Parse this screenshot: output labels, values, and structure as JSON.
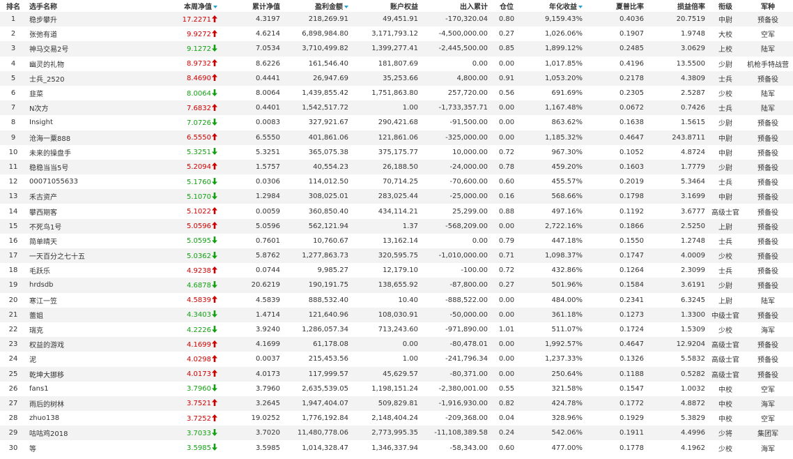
{
  "colors": {
    "up": "#cc0000",
    "down": "#12a012",
    "sort": "#2aa0c8",
    "stripe": "#f3f3f3"
  },
  "icons": {
    "rise": "up-arrow-icon",
    "fall": "down-arrow-icon",
    "sort": "sort-desc-icon"
  },
  "headers": {
    "rank": "排名",
    "name": "选手名称",
    "week_nav": "本周净值",
    "total_nav": "累计净值",
    "profit": "盈利金额",
    "equity": "账户权益",
    "inout": "出入累计",
    "position": "仓位",
    "annual": "年化收益",
    "sharpe": "夏普比率",
    "pl_ratio": "损益倍率",
    "rank_title": "衔级",
    "branch": "军种"
  },
  "sorted_columns": [
    "week_nav",
    "profit",
    "annual"
  ],
  "rows": [
    {
      "rank": "1",
      "name": "稳步攀升",
      "week_nav": "17.2271",
      "dir": "up",
      "total_nav": "4.3197",
      "profit": "218,269.91",
      "equity": "49,451.91",
      "inout": "-170,320.04",
      "position": "0.80",
      "annual": "9,159.43%",
      "sharpe": "0.4036",
      "pl_ratio": "20.7519",
      "rank_title": "中尉",
      "branch": "预备役"
    },
    {
      "rank": "2",
      "name": "张弛有道",
      "week_nav": "9.9272",
      "dir": "up",
      "total_nav": "4.6214",
      "profit": "6,898,984.80",
      "equity": "3,171,793.12",
      "inout": "-4,500,000.00",
      "position": "0.27",
      "annual": "1,026.06%",
      "sharpe": "0.1907",
      "pl_ratio": "1.9748",
      "rank_title": "大校",
      "branch": "空军"
    },
    {
      "rank": "3",
      "name": "神马交易2号",
      "week_nav": "9.1272",
      "dir": "down",
      "total_nav": "7.0534",
      "profit": "3,710,499.82",
      "equity": "1,399,277.41",
      "inout": "-2,445,500.00",
      "position": "0.85",
      "annual": "1,899.12%",
      "sharpe": "0.2485",
      "pl_ratio": "3.0629",
      "rank_title": "上校",
      "branch": "陆军"
    },
    {
      "rank": "4",
      "name": "幽灵的礼物",
      "week_nav": "8.9732",
      "dir": "up",
      "total_nav": "8.6226",
      "profit": "161,546.40",
      "equity": "181,807.69",
      "inout": "0.00",
      "position": "0.00",
      "annual": "1,017.85%",
      "sharpe": "0.4196",
      "pl_ratio": "13.5500",
      "rank_title": "少尉",
      "branch": "机枪手特战营"
    },
    {
      "rank": "5",
      "name": "士兵_2520",
      "week_nav": "8.4690",
      "dir": "up",
      "total_nav": "0.4441",
      "profit": "26,947.69",
      "equity": "35,253.66",
      "inout": "4,800.00",
      "position": "0.91",
      "annual": "1,053.20%",
      "sharpe": "0.2178",
      "pl_ratio": "4.3809",
      "rank_title": "士兵",
      "branch": "预备役"
    },
    {
      "rank": "6",
      "name": "韭菜",
      "week_nav": "8.0064",
      "dir": "down",
      "total_nav": "8.0064",
      "profit": "1,439,855.42",
      "equity": "1,751,863.80",
      "inout": "257,720.00",
      "position": "0.56",
      "annual": "691.69%",
      "sharpe": "0.2305",
      "pl_ratio": "2.5287",
      "rank_title": "少校",
      "branch": "陆军"
    },
    {
      "rank": "7",
      "name": "N次方",
      "week_nav": "7.6832",
      "dir": "up",
      "total_nav": "0.4401",
      "profit": "1,542,517.72",
      "equity": "1.00",
      "inout": "-1,733,357.71",
      "position": "0.00",
      "annual": "1,167.48%",
      "sharpe": "0.0672",
      "pl_ratio": "0.7426",
      "rank_title": "士兵",
      "branch": "陆军"
    },
    {
      "rank": "8",
      "name": "Insight",
      "week_nav": "7.0726",
      "dir": "down",
      "total_nav": "0.0083",
      "profit": "327,921.67",
      "equity": "290,421.68",
      "inout": "-91,500.00",
      "position": "0.00",
      "annual": "863.62%",
      "sharpe": "0.1638",
      "pl_ratio": "1.5615",
      "rank_title": "少尉",
      "branch": "预备役"
    },
    {
      "rank": "9",
      "name": "沧海一粟888",
      "week_nav": "6.5550",
      "dir": "up",
      "total_nav": "6.5550",
      "profit": "401,861.06",
      "equity": "121,861.06",
      "inout": "-325,000.00",
      "position": "0.00",
      "annual": "1,185.32%",
      "sharpe": "0.4647",
      "pl_ratio": "243.8711",
      "rank_title": "中尉",
      "branch": "预备役"
    },
    {
      "rank": "10",
      "name": "未来的操盘手",
      "week_nav": "5.3251",
      "dir": "down",
      "total_nav": "5.3251",
      "profit": "365,075.38",
      "equity": "375,175.77",
      "inout": "10,000.00",
      "position": "0.72",
      "annual": "967.30%",
      "sharpe": "0.1052",
      "pl_ratio": "4.8724",
      "rank_title": "中尉",
      "branch": "预备役"
    },
    {
      "rank": "11",
      "name": "稳稳当当5号",
      "week_nav": "5.2094",
      "dir": "up",
      "total_nav": "1.5757",
      "profit": "40,554.23",
      "equity": "26,188.50",
      "inout": "-24,000.00",
      "position": "0.78",
      "annual": "459.20%",
      "sharpe": "0.1603",
      "pl_ratio": "1.7779",
      "rank_title": "少尉",
      "branch": "预备役"
    },
    {
      "rank": "12",
      "name": "00071055633",
      "week_nav": "5.1760",
      "dir": "down",
      "total_nav": "0.0306",
      "profit": "114,012.50",
      "equity": "70,714.25",
      "inout": "-70,600.00",
      "position": "0.60",
      "annual": "455.57%",
      "sharpe": "0.2019",
      "pl_ratio": "5.3464",
      "rank_title": "士兵",
      "branch": "预备役"
    },
    {
      "rank": "13",
      "name": "禾古资产",
      "week_nav": "5.1070",
      "dir": "down",
      "total_nav": "1.2984",
      "profit": "308,025.01",
      "equity": "283,025.44",
      "inout": "-25,000.00",
      "position": "0.16",
      "annual": "568.66%",
      "sharpe": "0.1798",
      "pl_ratio": "3.1699",
      "rank_title": "中尉",
      "branch": "预备役"
    },
    {
      "rank": "14",
      "name": "攀西期客",
      "week_nav": "5.1022",
      "dir": "up",
      "total_nav": "0.0059",
      "profit": "360,850.40",
      "equity": "434,114.21",
      "inout": "25,299.00",
      "position": "0.88",
      "annual": "497.16%",
      "sharpe": "0.1192",
      "pl_ratio": "3.6777",
      "rank_title": "高级士官",
      "branch": "预备役"
    },
    {
      "rank": "15",
      "name": "不死鸟1号",
      "week_nav": "5.0596",
      "dir": "up",
      "total_nav": "5.0596",
      "profit": "562,121.94",
      "equity": "1.37",
      "inout": "-568,209.00",
      "position": "0.00",
      "annual": "2,722.16%",
      "sharpe": "0.1866",
      "pl_ratio": "2.5250",
      "rank_title": "上尉",
      "branch": "预备役"
    },
    {
      "rank": "16",
      "name": "简单晴天",
      "week_nav": "5.0595",
      "dir": "down",
      "total_nav": "0.7601",
      "profit": "10,760.67",
      "equity": "13,162.14",
      "inout": "0.00",
      "position": "0.79",
      "annual": "447.18%",
      "sharpe": "0.1550",
      "pl_ratio": "1.2748",
      "rank_title": "士兵",
      "branch": "预备役"
    },
    {
      "rank": "17",
      "name": "一天百分之七十五",
      "week_nav": "5.0362",
      "dir": "down",
      "total_nav": "5.8762",
      "profit": "1,277,863.73",
      "equity": "320,595.75",
      "inout": "-1,010,000.00",
      "position": "0.71",
      "annual": "1,098.37%",
      "sharpe": "0.1747",
      "pl_ratio": "4.0009",
      "rank_title": "少校",
      "branch": "预备役"
    },
    {
      "rank": "18",
      "name": "毛跃乐",
      "week_nav": "4.9238",
      "dir": "up",
      "total_nav": "0.0744",
      "profit": "9,985.27",
      "equity": "12,179.10",
      "inout": "-100.00",
      "position": "0.72",
      "annual": "432.86%",
      "sharpe": "0.1264",
      "pl_ratio": "2.3099",
      "rank_title": "士兵",
      "branch": "预备役"
    },
    {
      "rank": "19",
      "name": "hrdsdb",
      "week_nav": "4.6878",
      "dir": "down",
      "total_nav": "20.6219",
      "profit": "190,191.75",
      "equity": "138,655.92",
      "inout": "-87,800.00",
      "position": "0.27",
      "annual": "501.96%",
      "sharpe": "0.1584",
      "pl_ratio": "3.6191",
      "rank_title": "少尉",
      "branch": "预备役"
    },
    {
      "rank": "20",
      "name": "寒江一笠",
      "week_nav": "4.5839",
      "dir": "up",
      "total_nav": "4.5839",
      "profit": "888,532.40",
      "equity": "10.40",
      "inout": "-888,522.00",
      "position": "0.00",
      "annual": "484.00%",
      "sharpe": "0.2341",
      "pl_ratio": "6.3245",
      "rank_title": "上尉",
      "branch": "陆军"
    },
    {
      "rank": "21",
      "name": "蕾姐",
      "week_nav": "4.3403",
      "dir": "down",
      "total_nav": "1.4714",
      "profit": "121,640.96",
      "equity": "108,030.91",
      "inout": "-50,000.00",
      "position": "0.00",
      "annual": "361.18%",
      "sharpe": "0.1273",
      "pl_ratio": "1.3300",
      "rank_title": "中级士官",
      "branch": "预备役"
    },
    {
      "rank": "22",
      "name": "瑞克",
      "week_nav": "4.2226",
      "dir": "down",
      "total_nav": "3.9240",
      "profit": "1,286,057.34",
      "equity": "713,243.60",
      "inout": "-971,890.00",
      "position": "1.01",
      "annual": "511.07%",
      "sharpe": "0.1724",
      "pl_ratio": "1.5309",
      "rank_title": "少校",
      "branch": "海军"
    },
    {
      "rank": "23",
      "name": "权益的游戏",
      "week_nav": "4.1699",
      "dir": "up",
      "total_nav": "4.1699",
      "profit": "61,178.08",
      "equity": "0.00",
      "inout": "-80,478.01",
      "position": "0.00",
      "annual": "1,992.57%",
      "sharpe": "0.4647",
      "pl_ratio": "12.9204",
      "rank_title": "高级士官",
      "branch": "预备役"
    },
    {
      "rank": "24",
      "name": "泥",
      "week_nav": "4.0298",
      "dir": "up",
      "total_nav": "0.0037",
      "profit": "215,453.56",
      "equity": "1.00",
      "inout": "-241,796.34",
      "position": "0.00",
      "annual": "1,237.33%",
      "sharpe": "0.1326",
      "pl_ratio": "5.5832",
      "rank_title": "高级士官",
      "branch": "预备役"
    },
    {
      "rank": "25",
      "name": "乾坤大挪移",
      "week_nav": "4.0173",
      "dir": "up",
      "total_nav": "4.0173",
      "profit": "117,999.57",
      "equity": "45,629.57",
      "inout": "-80,371.00",
      "position": "0.00",
      "annual": "250.64%",
      "sharpe": "0.1188",
      "pl_ratio": "0.5282",
      "rank_title": "高级士官",
      "branch": "预备役"
    },
    {
      "rank": "26",
      "name": "fans1",
      "week_nav": "3.7960",
      "dir": "down",
      "total_nav": "3.7960",
      "profit": "2,635,539.05",
      "equity": "1,198,151.24",
      "inout": "-2,380,001.00",
      "position": "0.55",
      "annual": "321.58%",
      "sharpe": "0.1547",
      "pl_ratio": "1.0032",
      "rank_title": "中校",
      "branch": "空军"
    },
    {
      "rank": "27",
      "name": "雨后的树林",
      "week_nav": "3.7521",
      "dir": "up",
      "total_nav": "3.2645",
      "profit": "1,947,404.07",
      "equity": "509,829.81",
      "inout": "-1,916,930.00",
      "position": "0.82",
      "annual": "424.78%",
      "sharpe": "0.1772",
      "pl_ratio": "4.8872",
      "rank_title": "中校",
      "branch": "海军"
    },
    {
      "rank": "28",
      "name": "zhuo138",
      "week_nav": "3.7252",
      "dir": "up",
      "total_nav": "19.0252",
      "profit": "1,776,192.84",
      "equity": "2,148,404.24",
      "inout": "-209,368.00",
      "position": "0.04",
      "annual": "328.96%",
      "sharpe": "0.1929",
      "pl_ratio": "5.3829",
      "rank_title": "中校",
      "branch": "空军"
    },
    {
      "rank": "29",
      "name": "咕咕鸡2018",
      "week_nav": "3.7033",
      "dir": "down",
      "total_nav": "3.7020",
      "profit": "11,480,778.06",
      "equity": "2,773,995.35",
      "inout": "-11,108,389.58",
      "position": "0.24",
      "annual": "542.06%",
      "sharpe": "0.1911",
      "pl_ratio": "4.4996",
      "rank_title": "少将",
      "branch": "集团军"
    },
    {
      "rank": "30",
      "name": "等",
      "week_nav": "3.5985",
      "dir": "down",
      "total_nav": "3.5985",
      "profit": "1,014,328.47",
      "equity": "1,346,337.94",
      "inout": "-58,343.00",
      "position": "0.60",
      "annual": "477.00%",
      "sharpe": "0.1778",
      "pl_ratio": "4.1962",
      "rank_title": "少校",
      "branch": "海军"
    }
  ]
}
